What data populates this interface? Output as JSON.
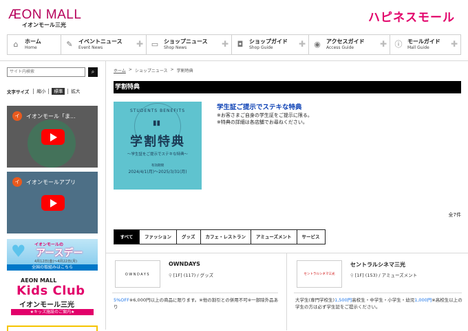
{
  "header": {
    "logo_main": "ÆON MALL",
    "logo_sub": "イオンモール三光",
    "happiness_logo": "ハピネスモール"
  },
  "nav": [
    {
      "jp": "ホーム",
      "en": "Home",
      "icon": "home-icon",
      "glyph": "⌂",
      "w": 78,
      "plus": false
    },
    {
      "jp": "イベントニュース",
      "en": "Event News",
      "icon": "bulb-icon",
      "glyph": "✎",
      "w": 124,
      "plus": true
    },
    {
      "jp": "ショップニュース",
      "en": "Shop News",
      "icon": "cart-icon",
      "glyph": "▭",
      "w": 124,
      "plus": true
    },
    {
      "jp": "ショップガイド",
      "en": "Shop Guide",
      "icon": "bag-icon",
      "glyph": "◘",
      "w": 112,
      "plus": true
    },
    {
      "jp": "アクセスガイド",
      "en": "Access Guide",
      "icon": "compass-icon",
      "glyph": "◉",
      "w": 118,
      "plus": true
    },
    {
      "jp": "モールガイド",
      "en": "Mall Guide",
      "icon": "info-icon",
      "glyph": "ⓘ",
      "w": 102,
      "plus": true
    }
  ],
  "sidebar": {
    "search_placeholder": "サイト内検索",
    "font_size_label": "文字サイズ",
    "font_sizes": [
      "縮小",
      "標準",
      "拡大"
    ],
    "video1_title": "イオンモール「ま...",
    "video2_title": "イオンモールアプリ",
    "video_avatar": "イ",
    "banner1": {
      "top": "イオンモールの",
      "title": "アースデー",
      "date": "4月12日(金)〜4月22日(月)",
      "bar": "全国の取組みはこちら"
    },
    "banner2": {
      "top": "AEON MALL",
      "title": "Kids Club",
      "mall": "イオンモール三光",
      "bar": "★キッズ施設のご案内★"
    }
  },
  "breadcrumb": [
    "ホーム",
    "ショップニュース",
    "学割特典"
  ],
  "page_title": "学割特典",
  "hero": {
    "arc": "STUDENTS BENEFITS",
    "title": "学割特典",
    "subtitle": "〜学生証をご提示でステキな特典〜",
    "period_label": "有効期間",
    "period": "2024/4/1(月)〜2025/3/31(月)"
  },
  "info": {
    "heading": "学生証ご提示でステキな特典",
    "line1": "※お客さまご自身の学生証をご提示に限る。",
    "line2": "※特典の詳細は各店舗でお尋ねください。"
  },
  "count": "全7件",
  "tabs": [
    "すべて",
    "ファッション",
    "グッズ",
    "カフェ・レストラン",
    "アミューズメント",
    "サービス"
  ],
  "cards": [
    {
      "logo": "OWNDAYS",
      "name": "OWNDAYS",
      "location": "[1F] (117) / グッズ",
      "desc_hl": "5%OFF",
      "desc": "※6,000円以上の商品に限ります。※他の割引との併用不可※一部除外品あり"
    },
    {
      "logo": "セントラルシネマ三光",
      "name": "セントラルシネマ三光",
      "location": "[1F] (153) / アミューズメント",
      "desc_pre": "大学生(専門学校生)",
      "price1": "1,500円",
      "desc_mid": "高校生・中学生・小学生・幼児",
      "price2": "1,000円",
      "desc_post": "※高校生以上の学生の方は必ず学生証をご提示ください。"
    }
  ],
  "colors": {
    "brand": "#b6005b",
    "happy": "#e2006a",
    "link": "#0a3fb4",
    "hero_bg": "#5fc3cf",
    "highlight": "#1a73e8"
  }
}
